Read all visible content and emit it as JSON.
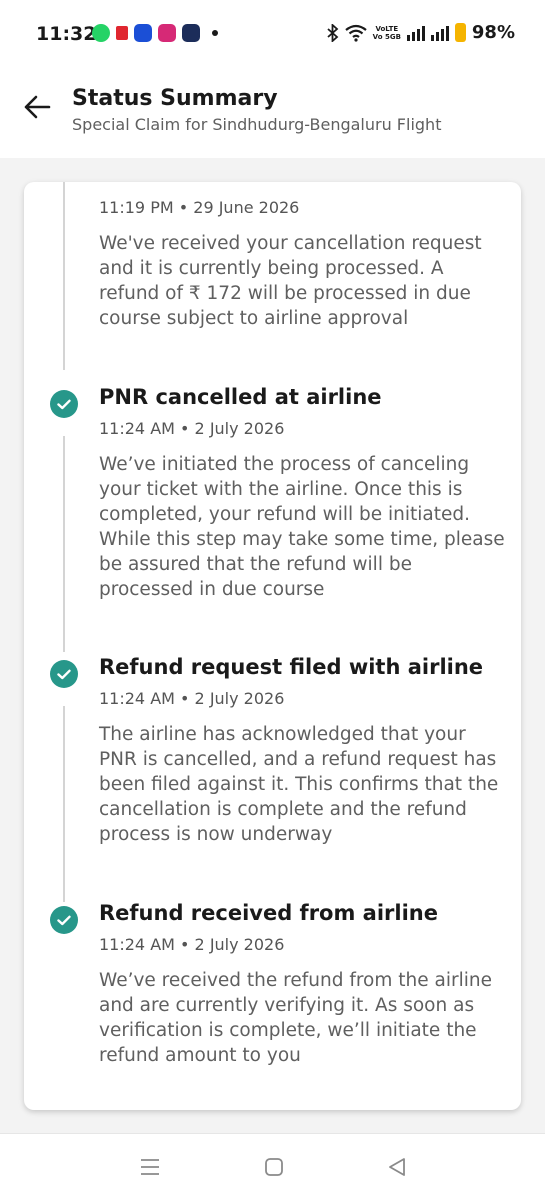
{
  "status_bar": {
    "time": "11:32",
    "volte_line1": "VoLTE",
    "volte_line2": "Vo 5GB",
    "battery": "98%"
  },
  "header": {
    "title": "Status Summary",
    "subtitle": "Special Claim for Sindhudurg-Bengaluru Flight"
  },
  "timeline": [
    {
      "title": "",
      "time": "11:19 PM • 29 June 2026",
      "description": "We've received your cancellation request and it is currently being processed. A refund of ₹ 172 will be processed in due course subject to airline approval"
    },
    {
      "title": "PNR cancelled at airline",
      "time": "11:24 AM • 2 July 2026",
      "description": "We’ve initiated the process of canceling your ticket with the airline. Once this is completed, your refund will be initiated. While this step may take some time, please be assured that the refund will be processed in due course"
    },
    {
      "title": "Refund request filed with airline",
      "time": "11:24 AM • 2 July 2026",
      "description": "The airline has acknowledged that your PNR is cancelled, and a refund request has been filed against it. This confirms that the cancellation is complete and the refund process is now underway"
    },
    {
      "title": "Refund received from airline",
      "time": "11:24 AM • 2 July 2026",
      "description": "We’ve received the refund from the airline and are currently verifying it. As soon as verification is complete, we’ll initiate the refund amount to you"
    }
  ],
  "colors": {
    "accent": "#27978a",
    "line": "#d4d4d4"
  },
  "icons": {
    "back": "back-arrow-icon",
    "step": "check-circle-icon",
    "nav_recents": "recents-icon",
    "nav_home": "home-icon",
    "nav_back": "nav-back-icon"
  }
}
